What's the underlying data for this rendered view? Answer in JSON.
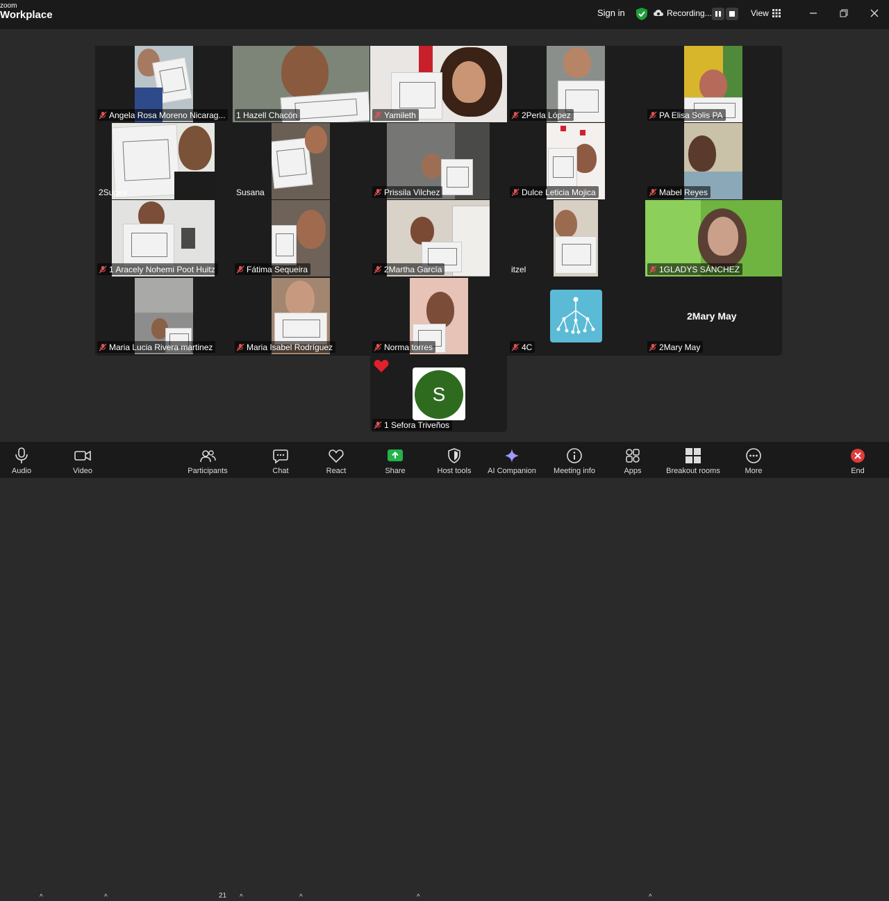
{
  "app": {
    "brand_small": "zoom",
    "brand_big": "Workplace"
  },
  "topbar": {
    "sign_in": "Sign in",
    "recording": "Recording...",
    "view": "View"
  },
  "participants": [
    {
      "name": "Angela Rosa Moreno Nicarag...",
      "muted": true
    },
    {
      "name": "1 Hazell Chacón",
      "muted": true,
      "active": true
    },
    {
      "name": "Yamileth",
      "muted": true
    },
    {
      "name": "2Perla López",
      "muted": true
    },
    {
      "name": "PA Elisa Solis   PA",
      "muted": true
    },
    {
      "name": "2Sugey",
      "muted": false
    },
    {
      "name": "Susana",
      "muted": false
    },
    {
      "name": "Prissila Vilchez",
      "muted": true
    },
    {
      "name": "Dulce Leticia Mojica",
      "muted": true
    },
    {
      "name": "Mabel Reyes",
      "muted": true
    },
    {
      "name": "1 Aracely Nohemi Poot Huitz",
      "muted": true
    },
    {
      "name": "Fátima Sequeira",
      "muted": true
    },
    {
      "name": "2Martha García",
      "muted": true
    },
    {
      "name": "itzel",
      "muted": false
    },
    {
      "name": "1GLADYS SÁNCHEZ",
      "muted": true
    },
    {
      "name": "Maria Lucia Rivera martinez",
      "muted": true
    },
    {
      "name": "Maria Isabel Rodríguez",
      "muted": true
    },
    {
      "name": "Norma torres",
      "muted": true
    },
    {
      "name": "4C",
      "muted": true
    },
    {
      "name": "2Mary May",
      "muted": true,
      "display_name": "2Mary May"
    },
    {
      "name": "1 Sefora Triveños",
      "muted": true,
      "avatar_letter": "S"
    }
  ],
  "toolbar": {
    "audio": "Audio",
    "video": "Video",
    "participants": "Participants",
    "participants_count": "21",
    "chat": "Chat",
    "react": "React",
    "share": "Share",
    "host_tools": "Host tools",
    "ai_companion": "AI Companion",
    "meeting_info": "Meeting info",
    "apps": "Apps",
    "breakout_rooms": "Breakout rooms",
    "more": "More",
    "end": "End"
  },
  "colors": {
    "active_border": "#3ddc97",
    "recording_dot": "#1f9d3a",
    "share_green": "#23b24b",
    "end_red": "#e03b3b"
  }
}
